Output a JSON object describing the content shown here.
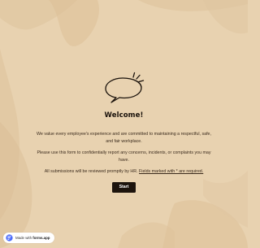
{
  "form": {
    "title": "Welcome!",
    "paragraph_1": "We value every employee's experience and are committed to maintaining a respectful, safe, and fair workplace.",
    "paragraph_2": "Please use this form to confidentially report any concerns, incidents, or complaints you may have.",
    "paragraph_3_prefix": "All submissions will be reviewed promptly by HR. ",
    "paragraph_3_link": "Fields marked with * are required.",
    "start_label": "Start",
    "icon": "speech-bubble-icon"
  },
  "badge": {
    "prefix": "Made with ",
    "brand": "forms.app",
    "icon": "forms-app-logo-icon"
  },
  "colors": {
    "background": "#e8d2b0",
    "brush_strokes": "#dfc39c",
    "button": "#1d140d",
    "text": "#2a1d12"
  }
}
